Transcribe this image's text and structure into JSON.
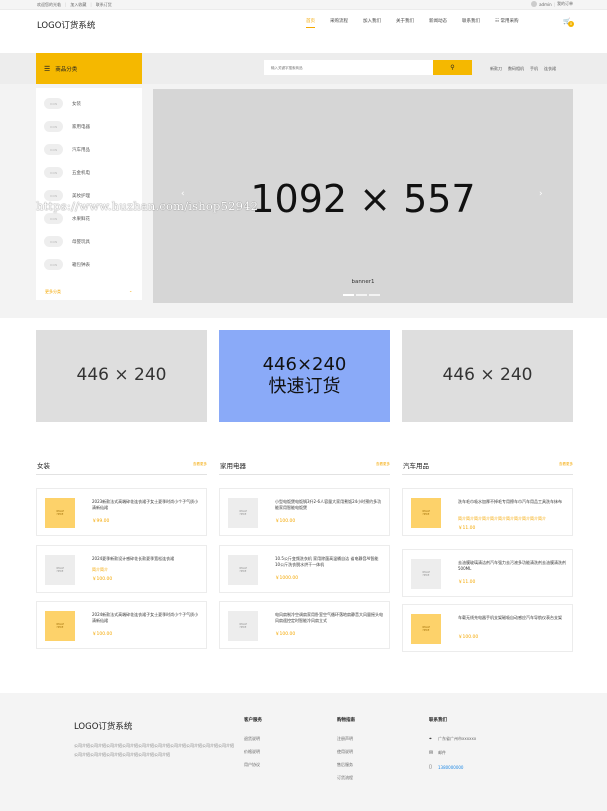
{
  "topbar": {
    "welcome": "欢迎您的光临",
    "join": "加入收藏",
    "contact": "联系订货",
    "username": "admin",
    "my_orders": "我的订单"
  },
  "header": {
    "logo": "LOGO订货系统",
    "nav": [
      "首页",
      "采购流程",
      "加入我们",
      "关于我们",
      "新闻动态",
      "联系我们",
      "常用采购"
    ],
    "cart_count": "0"
  },
  "category_bar": {
    "title": "商品分类",
    "search_placeholder": "输入关键字搜索商品",
    "hot_words": [
      "新款刀",
      "数码相机",
      "手机",
      "连衣裙"
    ]
  },
  "side_menu": {
    "icon_text": "ICON",
    "items": [
      "女装",
      "家用电器",
      "汽车用品",
      "五金机电",
      "美妆护理",
      "水果鲜花",
      "母婴玩具",
      "箱包钟表"
    ],
    "more": "更多分类"
  },
  "banner": {
    "size_text": "1092 × 557",
    "caption": "banner1",
    "watermark": "https://www.huzhan.com/ishop52942"
  },
  "promos": [
    {
      "line1": "446 × 240",
      "line2": ""
    },
    {
      "line1": "446×240",
      "line2": "快速订货"
    },
    {
      "line1": "446 × 240",
      "line2": ""
    }
  ],
  "sections": [
    {
      "title": "女装",
      "more": "查看更多",
      "products": [
        {
          "name": "2023新款法式高端碎花连衣裙子女士夏季时尚小个子气质小清新仙裙",
          "desc": "",
          "price": "￥99.00",
          "img": "yellow"
        },
        {
          "name": "2024夏季新款设计感碎花长款夏季宽松连衣裙",
          "desc": "简介简介",
          "price": "￥100.00",
          "img": "gray"
        },
        {
          "name": "2024新款法式高端碎花连衣裙子女士夏季时尚小个子气质小清新仙裙",
          "desc": "",
          "price": "￥100.00",
          "img": "yellow"
        }
      ]
    },
    {
      "title": "家用电器",
      "more": "查看更多",
      "products": [
        {
          "name": "小型电饭煲电饭锅3升2-6人容量大家用煮饭24小时预约多功能家用智能电饭煲",
          "desc": "",
          "price": "￥100.00",
          "img": "gray"
        },
        {
          "name": "10.5公斤变频洗衣机 家用除菌高温桶自洁 省电静音AI智能 10公斤洗衣脱水烘干一体机",
          "desc": "",
          "price": "￥1000.00",
          "img": "gray"
        },
        {
          "name": "电风扇制冷空调扇家用卧室空气循环落地扇静音大风量摇头电风扇遥控定时智能冷风扇立式",
          "desc": "",
          "price": "￥100.00",
          "img": "gray"
        }
      ]
    },
    {
      "title": "汽车用品",
      "more": "查看更多",
      "products": [
        {
          "name": "洗车毛巾吸水加厚不掉毛专用擦车巾汽车用品工具洗车抹布",
          "desc": "简介简介简介简介简介简介简介简介简介简介简介",
          "price": "￥11.00",
          "img": "yellow"
        },
        {
          "name": "去油膜玻璃清洁剂汽车强力去污液多功能清洗剂去油膜清洗剂500ML",
          "desc": "",
          "price": "￥11.00",
          "img": "gray"
        },
        {
          "name": "车载无线充电器手机支架磁吸自动感应汽车导航仪表台支架",
          "desc": "",
          "price": "￥100.00",
          "img": "yellow"
        }
      ]
    }
  ],
  "footer": {
    "logo": "LOGO订货系统",
    "company": "公司介绍公司介绍公司介绍公司介绍公司介绍公司介绍公司介绍公司介绍公司介绍公司介绍公司介绍公司介绍公司介绍公司介绍公司介绍公司介绍",
    "columns": [
      {
        "title": "客户服务",
        "links": [
          "退货说明",
          "价格说明",
          "用户协议"
        ]
      },
      {
        "title": "购物指南",
        "links": [
          "注册声明",
          "使用说明",
          "售后服务",
          "订货流程"
        ]
      }
    ],
    "contact_title": "联系我们",
    "address": "广东省广州市xxxxxx",
    "email": "邮件",
    "phone": "1380000000"
  }
}
